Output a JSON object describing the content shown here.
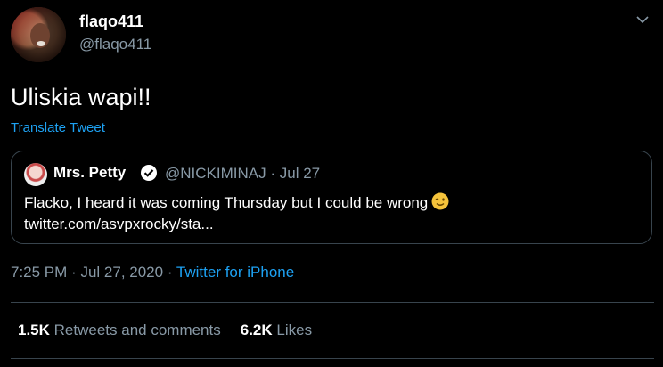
{
  "author": {
    "display_name": "flaqo411",
    "handle": "@flaqo411"
  },
  "tweet": {
    "text": "Uliskia wapi!!",
    "translate_label": "Translate Tweet"
  },
  "quoted_tweet": {
    "display_name": "Mrs. Petty",
    "handle": "@NICKIMINAJ",
    "separator": "·",
    "date": "Jul 27",
    "text_line1": "Flacko, I heard it was coming Thursday but I could be wrong",
    "text_line2": "twitter.com/asvpxrocky/sta...",
    "emoji": "winking-face"
  },
  "meta": {
    "time": "7:25 PM",
    "separator": "·",
    "date": "Jul 27, 2020",
    "source": "Twitter for iPhone"
  },
  "stats": {
    "retweets_count": "1.5K",
    "retweets_label": "Retweets and comments",
    "likes_count": "6.2K",
    "likes_label": "Likes"
  },
  "colors": {
    "background": "#000000",
    "accent": "#1da1f2",
    "muted": "#8899a6",
    "border": "#38444d"
  }
}
